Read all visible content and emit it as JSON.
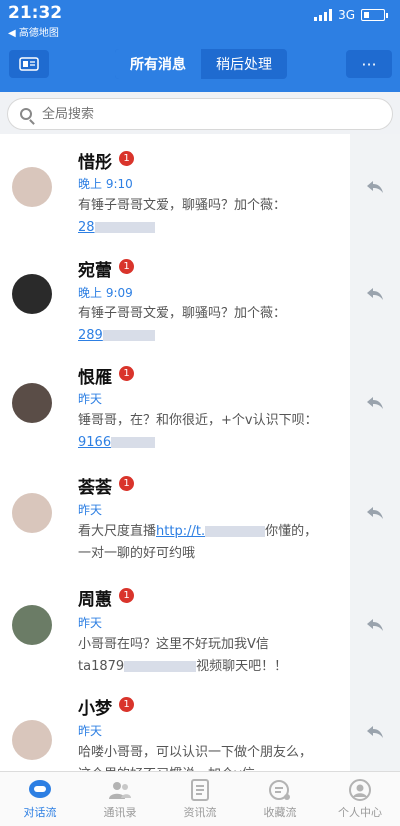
{
  "status_bar": {
    "time": "21:32",
    "back_app": "◀ 高德地图",
    "network": "3G"
  },
  "header": {
    "tab_all": "所有消息",
    "tab_later": "稍后处理",
    "more": "···"
  },
  "search": {
    "placeholder": "全局搜索"
  },
  "messages": [
    {
      "name": "惜彤",
      "badge": "1",
      "time": "晚上 9:10",
      "text": "有锤子哥哥文爱，聊骚吗？加个薇：",
      "num": "28"
    },
    {
      "name": "宛蕾",
      "badge": "1",
      "time": "晚上 9:09",
      "text": "有锤子哥哥文爱，聊骚吗？加个薇：",
      "num": "289"
    },
    {
      "name": "恨雁",
      "badge": "1",
      "time": "昨天",
      "text": "锤哥哥，在？和你很近，+个v认识下呗：",
      "num": "9166"
    },
    {
      "name": "荟荟",
      "badge": "1",
      "time": "昨天",
      "text_a": "看大尺度直播",
      "link": "http://t.",
      "text_b": "你懂的，一对一聊的好可约哦"
    },
    {
      "name": "周蕙",
      "badge": "1",
      "time": "昨天",
      "text_a": "小哥哥在吗？这里不好玩加我V信",
      "text_b": "ta1879",
      "text_c": "视频聊天吧！！"
    },
    {
      "name": "小梦",
      "badge": "1",
      "time": "昨天",
      "text": "哈喽小哥哥，可以认识一下做个朋友么，这个里的好不习惯说，加个v信"
    }
  ],
  "tabbar": [
    {
      "label": "对话流",
      "icon": "chat-bubble-icon"
    },
    {
      "label": "通讯录",
      "icon": "contacts-icon"
    },
    {
      "label": "资讯流",
      "icon": "news-icon"
    },
    {
      "label": "收藏流",
      "icon": "favorites-icon"
    },
    {
      "label": "个人中心",
      "icon": "profile-icon"
    }
  ],
  "colors": {
    "brand": "#2d7fe3",
    "badge": "#d9342b"
  }
}
